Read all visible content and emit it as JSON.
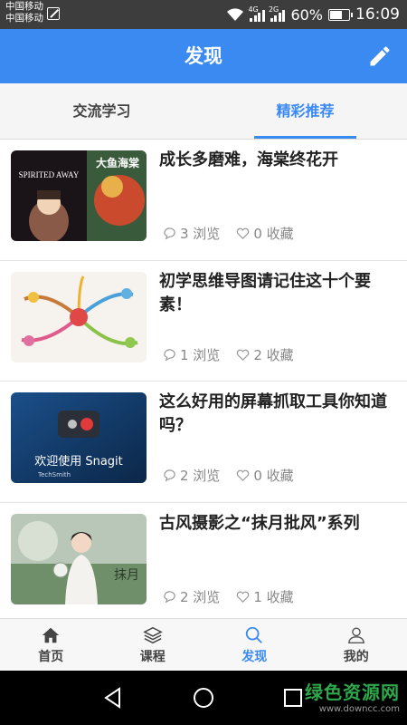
{
  "status": {
    "carrier1": "中国移动",
    "carrier2": "中国移动",
    "net1": "4G",
    "net2": "2G",
    "battery": "60%",
    "time": "16:09"
  },
  "appbar": {
    "title": "发现",
    "edit_icon": "pencil-icon"
  },
  "tabs": [
    {
      "label": "交流学习",
      "active": false
    },
    {
      "label": "精彩推荐",
      "active": true
    }
  ],
  "articles": [
    {
      "title": "成长多磨难，海棠终花开",
      "views": "3 浏览",
      "favorites": "0 收藏",
      "thumb_text": "SPIRITED AWAY"
    },
    {
      "title": "初学思维导图请记住这十个要素！",
      "views": "1 浏览",
      "favorites": "2 收藏",
      "thumb_text": ""
    },
    {
      "title": "这么好用的屏幕抓取工具你知道吗？",
      "views": "2 浏览",
      "favorites": "0 收藏",
      "thumb_text": "欢迎使用 Snagit",
      "thumb_sub": "TechSmith"
    },
    {
      "title": "古风摄影之“抹月批风”系列",
      "views": "2 浏览",
      "favorites": "1 收藏",
      "thumb_text": ""
    }
  ],
  "bottom_nav": [
    {
      "label": "首页",
      "icon": "home-icon",
      "active": false
    },
    {
      "label": "课程",
      "icon": "layers-icon",
      "active": false
    },
    {
      "label": "发现",
      "icon": "search-icon",
      "active": true
    },
    {
      "label": "我的",
      "icon": "user-icon",
      "active": false
    }
  ],
  "watermark": {
    "main": "绿色资源网",
    "sub": "www.downcc.com"
  },
  "colors": {
    "primary": "#3b8af2",
    "statusbar": "#3d3d3d"
  }
}
